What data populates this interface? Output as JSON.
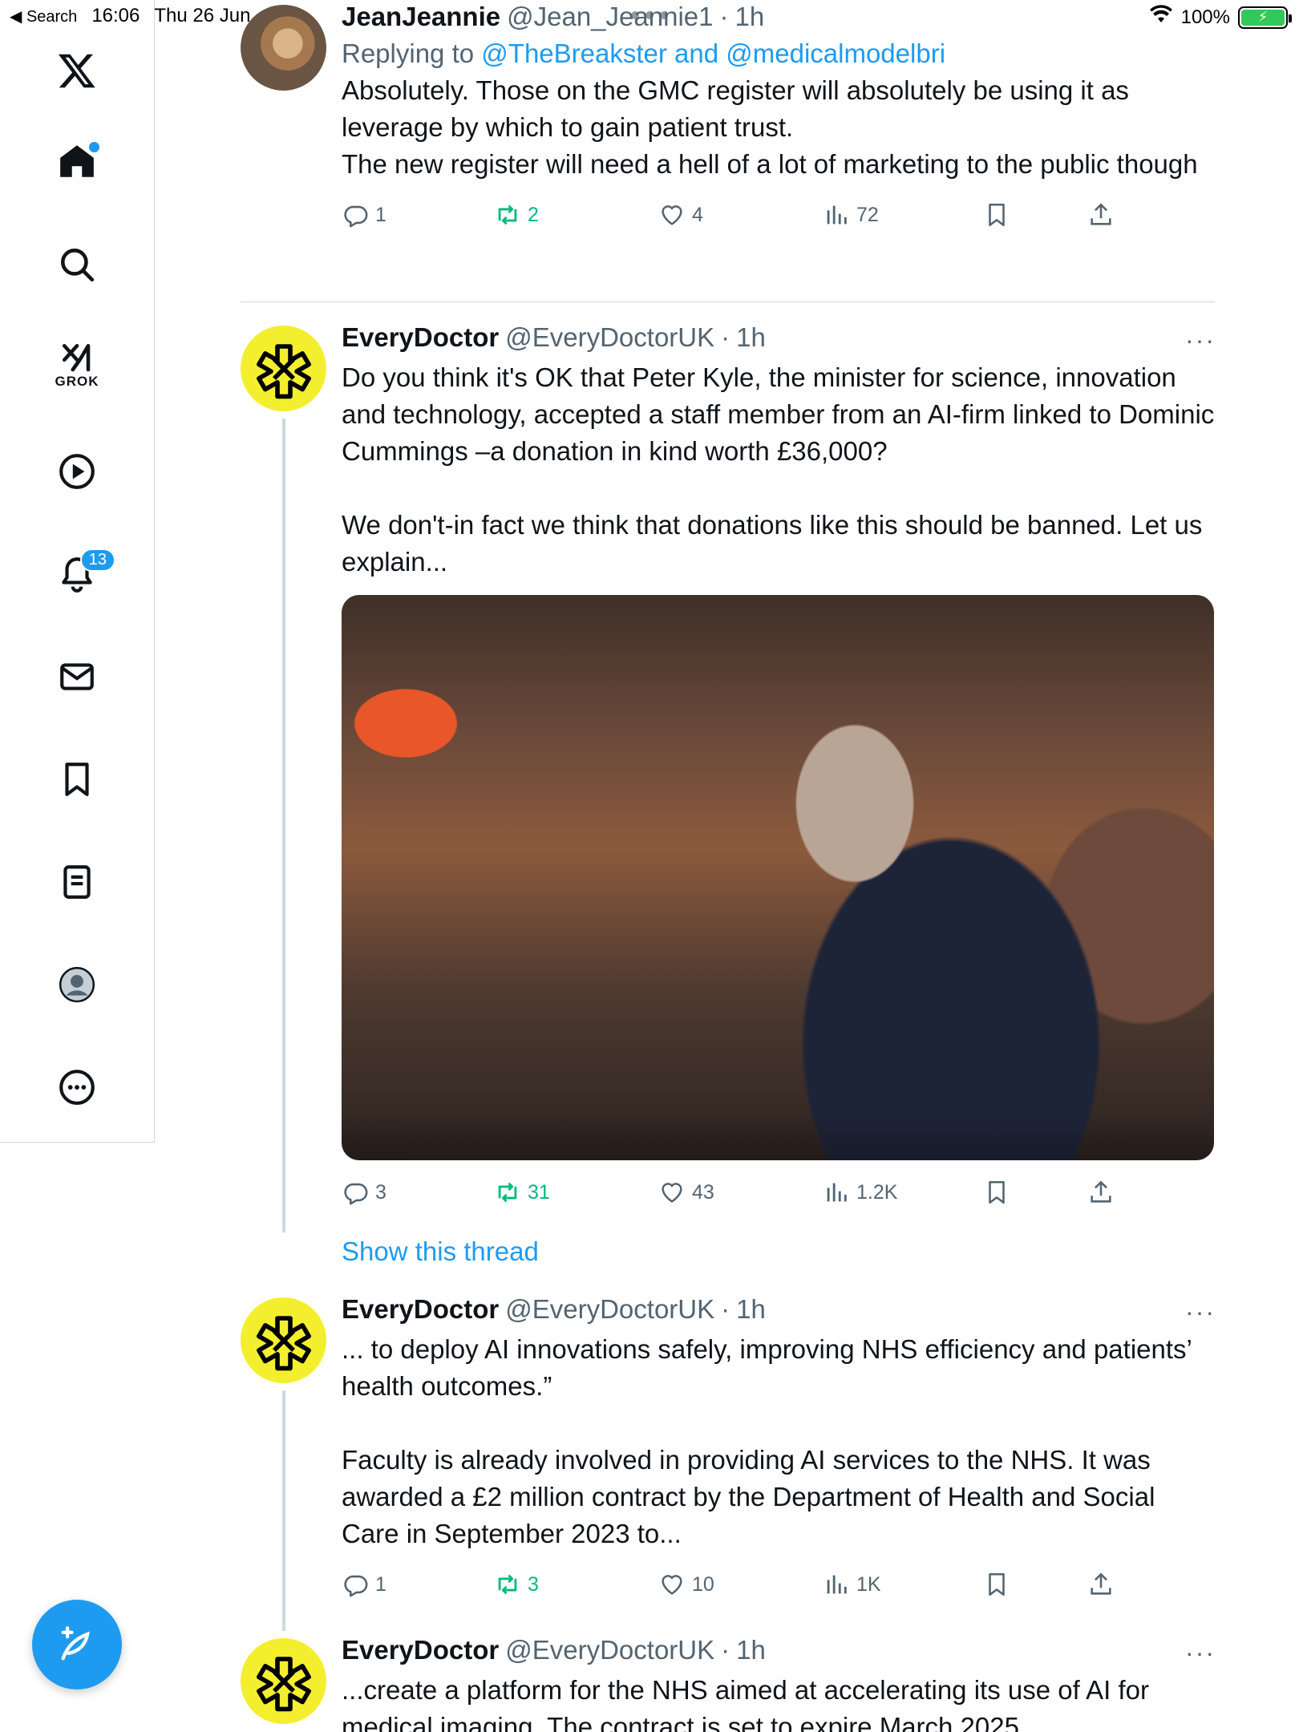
{
  "status_bar": {
    "back_label": "◀ Search",
    "time": "16:06",
    "date": "Thu 26 Jun",
    "battery": "100%"
  },
  "sidebar": {
    "items": [
      {
        "name": "x-logo",
        "icon": "x-logo"
      },
      {
        "name": "home",
        "icon": "home-icon"
      },
      {
        "name": "explore",
        "icon": "search-icon"
      },
      {
        "name": "grok",
        "icon": "grok-icon",
        "label": "GROK"
      },
      {
        "name": "videos",
        "icon": "play-icon"
      },
      {
        "name": "notifications",
        "icon": "bell-icon",
        "badge": "13"
      },
      {
        "name": "messages",
        "icon": "mail-icon"
      },
      {
        "name": "bookmarks",
        "icon": "bookmark-icon"
      },
      {
        "name": "lists",
        "icon": "list-icon"
      },
      {
        "name": "profile",
        "icon": "profile-icon"
      },
      {
        "name": "more",
        "icon": "more-icon"
      }
    ],
    "compose_icon": "compose-icon"
  },
  "tweets": [
    {
      "name": "JeanJeannie",
      "handle": "@Jean_Jeannie1",
      "time": "1h",
      "replying_prefix": "Replying to",
      "replying_to": "@TheBreakster and @medicalmodelbri",
      "text": "Absolutely. Those on the GMC register will absolutely be using it as leverage by which to gain patient trust.\nThe new register will need a hell of a lot of marketing to the public though",
      "replies": "1",
      "retweets": "2",
      "likes": "4",
      "views": "72"
    },
    {
      "name": "EveryDoctor",
      "handle": "@EveryDoctorUK",
      "time": "1h",
      "text": "Do you think it's OK that Peter Kyle, the minister for science, innovation and technology, accepted a staff member from an AI-firm linked to Dominic Cummings –a donation in kind worth £36,000?\n\nWe don't-in fact we think that donations like this should be banned. Let us explain...",
      "replies": "3",
      "retweets": "31",
      "likes": "43",
      "views": "1.2K",
      "show_thread": "Show this thread"
    },
    {
      "name": "EveryDoctor",
      "handle": "@EveryDoctorUK",
      "time": "1h",
      "text": "... to deploy AI innovations safely, improving NHS efficiency and patients’ health outcomes.”\n\nFaculty is already involved in providing AI services to the NHS. It was awarded a £2 million contract by the Department of Health and Social Care in September 2023 to...",
      "replies": "1",
      "retweets": "3",
      "likes": "10",
      "views": "1K"
    },
    {
      "name": "EveryDoctor",
      "handle": "@EveryDoctorUK",
      "time": "1h",
      "text": "...create a platform for the NHS aimed at accelerating its use of AI for medical imaging. The contract is set to expire March 2025"
    }
  ],
  "colors": {
    "accent": "#1d9bf0",
    "retweet": "#00ba7c",
    "muted": "#536471",
    "everydoctor_yellow": "#f4ef2e"
  }
}
